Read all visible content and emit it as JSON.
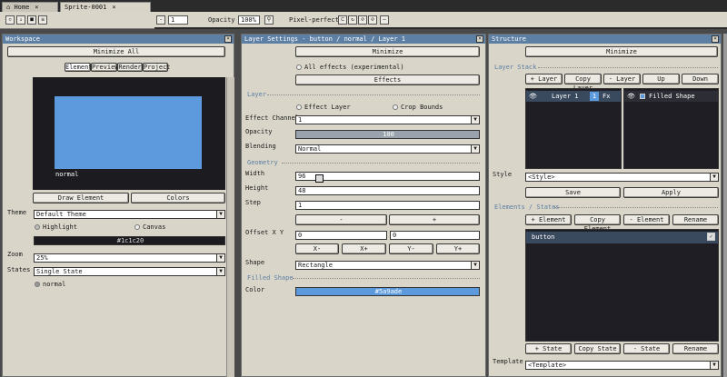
{
  "tabs": [
    {
      "label": "Home"
    },
    {
      "label": "Sprite-0001"
    }
  ],
  "toolbar": {
    "frame": "1",
    "opacity_label": "Opacity",
    "opacity": "100%",
    "pixel_perfect": "Pixel-perfect"
  },
  "workspace": {
    "title": "Workspace",
    "minimize": "Minimize All",
    "subtabs": [
      "Element",
      "Preview",
      "Render",
      "Project"
    ],
    "preview_label": "normal",
    "draw": "Draw Element",
    "colors": "Colors",
    "theme_label": "Theme",
    "theme": "Default Theme",
    "highlight": "Highlight",
    "canvas": "Canvas",
    "bg_color": "#1c1c20",
    "zoom_label": "Zoom",
    "zoom": "25%",
    "states_label": "States",
    "states": "Single State",
    "state_normal": "normal"
  },
  "layer_settings": {
    "title": "Layer Settings - button / normal / Layer 1",
    "minimize": "Minimize",
    "all_effects": "All effects (experimental)",
    "effects": "Effects",
    "layer_section": "Layer",
    "effect_layer": "Effect Layer",
    "crop_bounds": "Crop Bounds",
    "effect_channel_label": "Effect Channel",
    "effect_channel": "1",
    "opacity_label": "Opacity",
    "opacity": "100",
    "blending_label": "Blending",
    "blending": "Normal",
    "geometry_section": "Geometry",
    "width_label": "Width",
    "width": "96",
    "height_label": "Height",
    "height": "48",
    "step_label": "Step",
    "step": "1",
    "minus": "-",
    "plus": "+",
    "offset_label": "Offset X Y",
    "offset_x": "0",
    "offset_y": "0",
    "xm": "X-",
    "xp": "X+",
    "ym": "Y-",
    "yp": "Y+",
    "shape_label": "Shape",
    "shape": "Rectangle",
    "filled_section": "Filled Shape",
    "color_label": "Color",
    "color": "#5a9ade"
  },
  "structure": {
    "title": "Structure",
    "minimize": "Minimize",
    "layer_stack": "Layer Stack",
    "add_layer": "+ Layer",
    "copy_layer": "Copy Layer",
    "remove_layer": "- Layer",
    "up": "Up",
    "down": "Down",
    "layer1": "Layer 1",
    "layer1_num": "1",
    "layer1_fx": "Fx",
    "filled_shape": "Filled Shape",
    "style_label": "Style",
    "style": "<Style>",
    "save": "Save",
    "apply": "Apply",
    "elements_section": "Elements / States",
    "add_element": "+ Element",
    "copy_element": "Copy Element",
    "remove_element": "- Element",
    "rename": "Rename",
    "element_button": "button",
    "add_state": "+ State",
    "copy_state": "Copy State",
    "remove_state": "- State",
    "rename2": "Rename",
    "template_label": "Template",
    "template": "<Template>"
  },
  "colors": {
    "title_bar": "#5d7fa4",
    "accent": "#5c9add",
    "preview_bg": "#1c1c20"
  }
}
